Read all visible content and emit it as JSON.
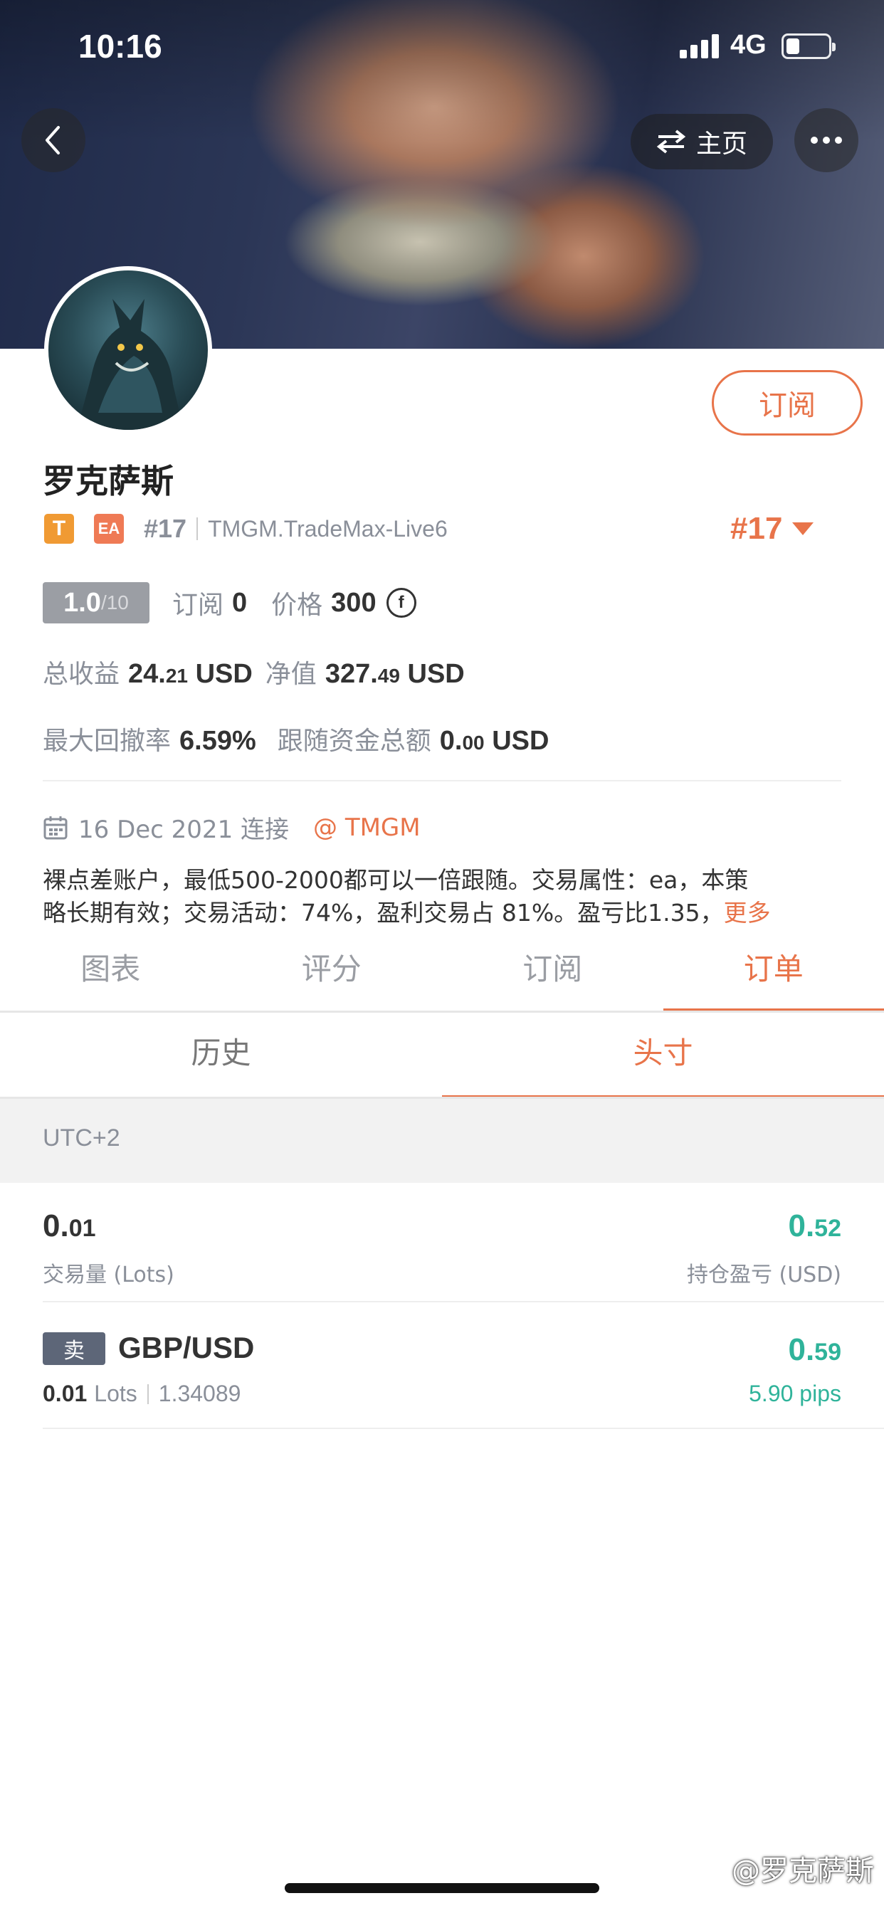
{
  "status_bar": {
    "time": "10:16",
    "network": "4G"
  },
  "header": {
    "home_label": "主页"
  },
  "profile": {
    "name": "罗克萨斯",
    "subscribe_label": "订阅",
    "badge_t": "T",
    "badge_ea": "EA",
    "rank_small": "#17",
    "broker_server": "TMGM.TradeMax-Live6",
    "rank_big": "#17"
  },
  "stats": {
    "score_value": "1.0",
    "score_max": "/10",
    "subscribers_label": "订阅",
    "subscribers_value": "0",
    "price_label": "价格",
    "price_value": "300",
    "coin_symbol": "f",
    "total_profit_label": "总收益",
    "total_profit_int": "24.",
    "total_profit_dec": "21",
    "total_profit_unit": "USD",
    "equity_label": "净值",
    "equity_int": "327.",
    "equity_dec": "49",
    "equity_unit": "USD",
    "max_drawdown_label": "最大回撤率",
    "max_drawdown_value": "6.59%",
    "follow_funds_label": "跟随资金总额",
    "follow_funds_int": "0.",
    "follow_funds_dec": "00",
    "follow_funds_unit": "USD"
  },
  "connection": {
    "date_text": "16 Dec 2021 连接",
    "broker_mention": "@ TMGM"
  },
  "description": {
    "line1": "裸点差账户，最低500-2000都可以一倍跟随。交易属性：ea，本策",
    "line2": "略长期有效；交易活动：74%，盈利交易占 81%。盈亏比1.35，",
    "more_label": "更多"
  },
  "tabs": [
    "图表",
    "评分",
    "订阅",
    "订单"
  ],
  "active_tab": "订单",
  "subtabs": [
    "历史",
    "头寸"
  ],
  "active_subtab": "头寸",
  "timezone": "UTC+2",
  "summary": {
    "volume_int": "0.",
    "volume_dec": "01",
    "volume_label": "交易量 (Lots)",
    "pnl_int": "0.",
    "pnl_dec": "52",
    "pnl_label": "持仓盈亏 (USD)"
  },
  "positions": [
    {
      "side": "卖",
      "symbol": "GBP/USD",
      "lots_value": "0.01",
      "lots_unit": "Lots",
      "price": "1.34089",
      "profit_int": "0.",
      "profit_dec": "59",
      "pips": "5.90 pips"
    }
  ],
  "watermark": "@罗克萨斯",
  "colors": {
    "accent": "#e8744a",
    "profit": "#2fb39a",
    "sell_badge": "#5d6678"
  }
}
